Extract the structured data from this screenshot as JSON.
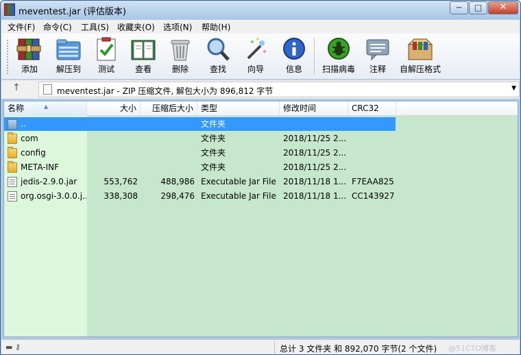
{
  "window": {
    "title": "meventest.jar (评估版本)",
    "controls": {
      "minimize": "─",
      "maximize": "□",
      "close": "✕"
    }
  },
  "menu": [
    "文件(F)",
    "命令(C)",
    "工具(S)",
    "收藏夹(O)",
    "选项(N)",
    "帮助(H)"
  ],
  "toolbar": [
    {
      "label": "添加",
      "icon": "add-archive-icon"
    },
    {
      "label": "解压到",
      "icon": "extract-to-icon"
    },
    {
      "label": "测试",
      "icon": "test-icon"
    },
    {
      "label": "查看",
      "icon": "view-icon"
    },
    {
      "label": "删除",
      "icon": "delete-icon"
    },
    {
      "label": "查找",
      "icon": "find-icon"
    },
    {
      "label": "向导",
      "icon": "wizard-icon"
    },
    {
      "label": "信息",
      "icon": "info-icon"
    },
    {
      "label": "扫描病毒",
      "icon": "virus-scan-icon"
    },
    {
      "label": "注释",
      "icon": "comment-icon"
    },
    {
      "label": "自解压格式",
      "icon": "sfx-icon"
    }
  ],
  "address": {
    "up": "↑",
    "text": "meventest.jar - ZIP 压缩文件, 解包大小为 896,812 字节",
    "dropdown": "▼"
  },
  "columns": {
    "name": "名称",
    "size": "大小",
    "packed": "压缩后大小",
    "type": "类型",
    "modified": "修改时间",
    "crc": "CRC32",
    "sort_indicator": "▲"
  },
  "files": [
    {
      "name": "..",
      "size": "",
      "packed": "",
      "type": "文件夹",
      "modified": "",
      "crc": "",
      "kind": "up",
      "selected": true
    },
    {
      "name": "com",
      "size": "",
      "packed": "",
      "type": "文件夹",
      "modified": "2018/11/25 2...",
      "crc": "",
      "kind": "folder",
      "selected": false
    },
    {
      "name": "config",
      "size": "",
      "packed": "",
      "type": "文件夹",
      "modified": "2018/11/25 2...",
      "crc": "",
      "kind": "folder",
      "selected": false
    },
    {
      "name": "META-INF",
      "size": "",
      "packed": "",
      "type": "文件夹",
      "modified": "2018/11/25 2...",
      "crc": "",
      "kind": "folder",
      "selected": false
    },
    {
      "name": "jedis-2.9.0.jar",
      "size": "553,762",
      "packed": "488,986",
      "type": "Executable Jar File",
      "modified": "2018/11/18 1...",
      "crc": "F7EAA825",
      "kind": "jar",
      "selected": false
    },
    {
      "name": "org.osgi-3.0.0.j...",
      "size": "338,308",
      "packed": "298,476",
      "type": "Executable Jar File",
      "modified": "2018/11/18 1...",
      "crc": "CC143927",
      "kind": "jar",
      "selected": false
    }
  ],
  "status": {
    "icons": "▬ ⚷",
    "text": "总计 3 文件夹 和 892,070 字节(2 个文件)",
    "watermark": "@51CTO博客"
  },
  "colors": {
    "list_bg": "#c6e7cb",
    "name_col_bg": "#dcf7dc",
    "selection": "#3399ff",
    "titlebar": "#a9c7e6"
  }
}
